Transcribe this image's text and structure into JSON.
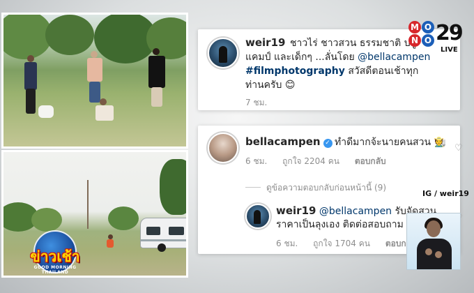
{
  "post": {
    "username": "weir19",
    "caption_line1": "ชาวไร่ ชาวสวน ธรรมชาติ ปลู",
    "caption_line2_pre": "แคมป์ และเด็กๆ ...ลั่นโดย ",
    "caption_mention": "@bellacampen",
    "caption_hashtag": "#filmphotography",
    "caption_line3_post": " สวัสดีตอนเช้าทุก",
    "caption_line4": "ท่านครับ 😊",
    "time": "7 ชม."
  },
  "comment1": {
    "username": "bellacampen",
    "verified_icon": "verified-badge-icon",
    "text": "ทำดีมากจ้ะนายคนสวน 🧑‍🌾",
    "time": "6 ชม.",
    "likes": "ถูกใจ 2204 คน",
    "reply": "ตอบกลับ"
  },
  "view_replies": "ดูข้อความตอบกลับก่อนหน้านี้ (9)",
  "reply1": {
    "username": "weir19",
    "mention": "@bellacampen",
    "text_line1_post": " รับจัดสวน",
    "text_line2": "ราคาเป็นลุงเอง ติดต่อสอบถาม",
    "time": "6 ชม.",
    "likes": "ถูกใจ 1704 คน",
    "reply": "ตอบกลั"
  },
  "channel": {
    "mono_letters": [
      "M",
      "O",
      "N",
      "O"
    ],
    "number": "29",
    "live": "LIVE",
    "colors": {
      "red": "#d7262b",
      "blue": "#1c5fb8"
    }
  },
  "credit": "IG / weir19",
  "show_logo": {
    "title": "ข่าวเช้า",
    "subtitle": "GOOD MORNING THAILAND"
  },
  "colors": {
    "link": "#00376b",
    "meta": "#8e8e8e",
    "text": "#262626",
    "verified": "#3897f0"
  }
}
